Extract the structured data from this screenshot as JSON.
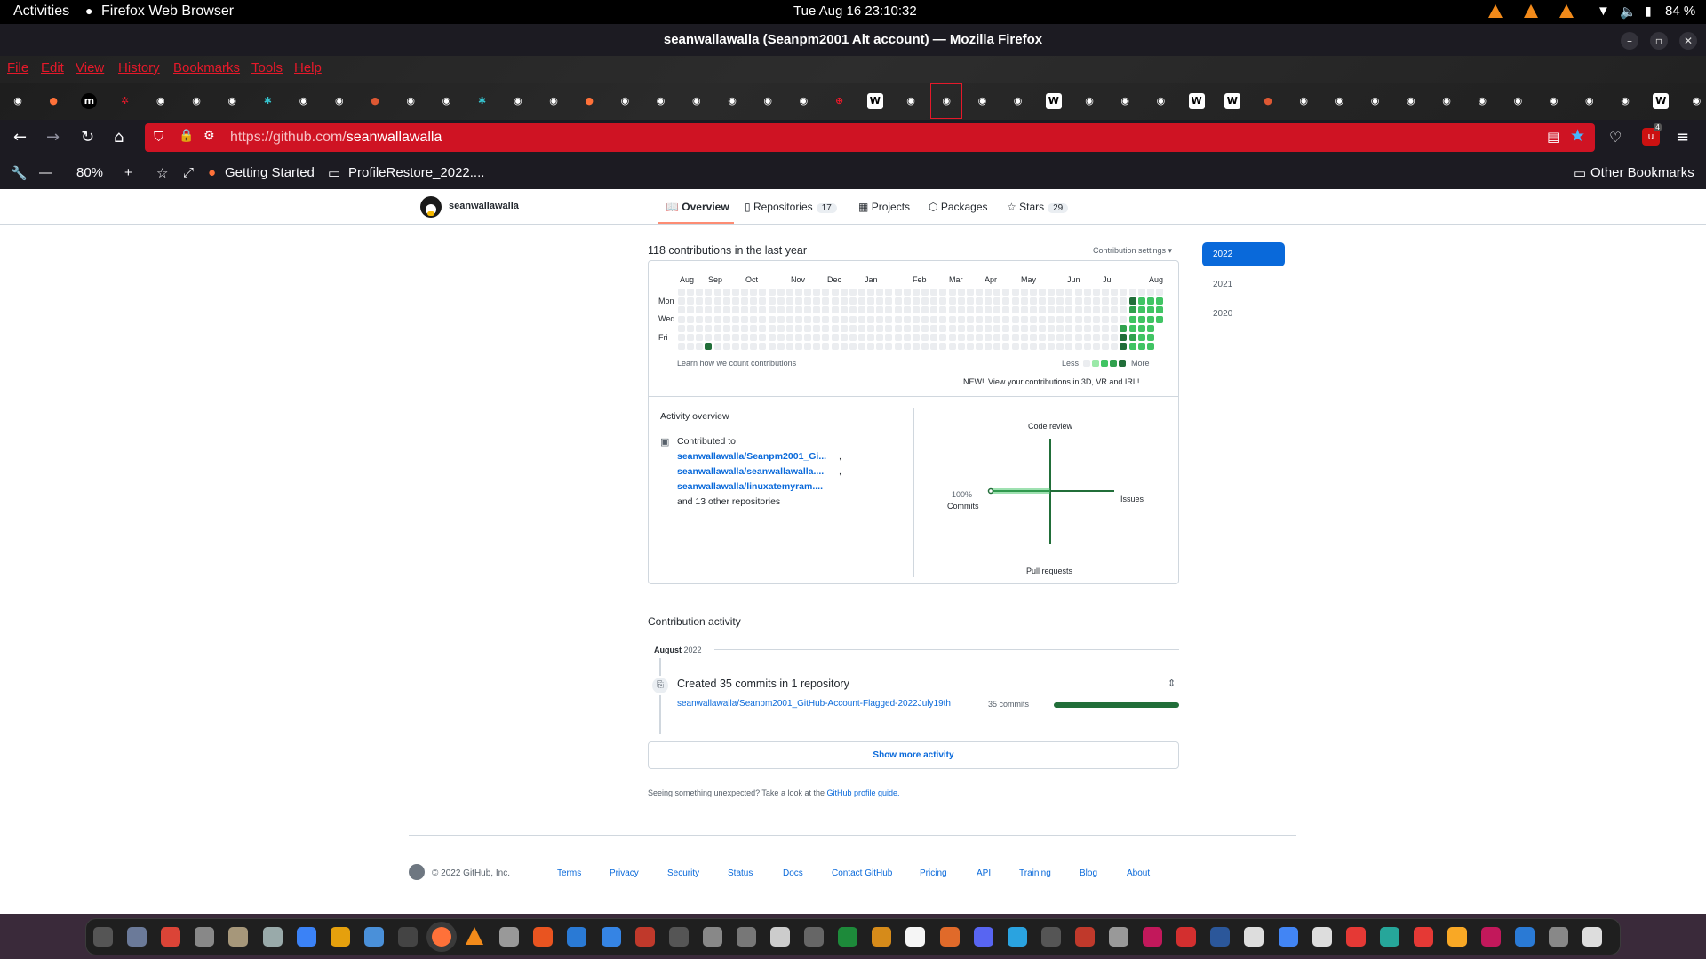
{
  "system": {
    "activities": "Activities",
    "app_name": "Firefox Web Browser",
    "datetime": "Tue Aug 16  23:10:32",
    "battery": "84 %"
  },
  "window": {
    "title": "seanwallawalla (Seanpm2001 Alt account) — Mozilla Firefox"
  },
  "menu": [
    "File",
    "Edit",
    "View",
    "History",
    "Bookmarks",
    "Tools",
    "Help"
  ],
  "tabs": [
    {
      "icon": "github-icon",
      "color": "#ffffff"
    },
    {
      "icon": "firefox-icon",
      "color": "#ff7139"
    },
    {
      "icon": "medium-icon",
      "color": "#ffffff"
    },
    {
      "icon": "settings-icon",
      "color": "#e5192a"
    },
    {
      "icon": "github-icon",
      "color": "#ffffff"
    },
    {
      "icon": "github-icon",
      "color": "#ffffff"
    },
    {
      "icon": "github-icon",
      "color": "#ffffff"
    },
    {
      "icon": "puzzle-icon",
      "color": "#36c5d0"
    },
    {
      "icon": "github-icon",
      "color": "#ffffff"
    },
    {
      "icon": "github-icon",
      "color": "#ffffff"
    },
    {
      "icon": "duckduckgo-icon",
      "color": "#de5833"
    },
    {
      "icon": "github-icon",
      "color": "#ffffff"
    },
    {
      "icon": "github-icon",
      "color": "#ffffff"
    },
    {
      "icon": "puzzle-icon",
      "color": "#36c5d0"
    },
    {
      "icon": "github-icon",
      "color": "#ffffff"
    },
    {
      "icon": "github-icon",
      "color": "#ffffff"
    },
    {
      "icon": "firefox-icon",
      "color": "#ff7139"
    },
    {
      "icon": "github-icon",
      "color": "#ffffff"
    },
    {
      "icon": "github-icon",
      "color": "#ffffff"
    },
    {
      "icon": "github-icon",
      "color": "#ffffff"
    },
    {
      "icon": "github-icon",
      "color": "#ffffff"
    },
    {
      "icon": "github-icon",
      "color": "#ffffff"
    },
    {
      "icon": "github-icon",
      "color": "#ffffff"
    },
    {
      "icon": "globe-icon",
      "color": "#e5192a"
    },
    {
      "icon": "wikipedia-icon",
      "color": "#ffffff"
    },
    {
      "icon": "github-icon",
      "color": "#ffffff"
    },
    {
      "icon": "github-icon",
      "color": "#ffffff",
      "selected": true
    },
    {
      "icon": "github-icon",
      "color": "#ffffff"
    },
    {
      "icon": "github-icon",
      "color": "#ffffff"
    },
    {
      "icon": "wikipedia-icon",
      "color": "#ffffff"
    },
    {
      "icon": "github-icon",
      "color": "#ffffff"
    },
    {
      "icon": "github-icon",
      "color": "#ffffff"
    },
    {
      "icon": "github-icon",
      "color": "#ffffff"
    },
    {
      "icon": "wikipedia-icon",
      "color": "#ffffff"
    },
    {
      "icon": "wikipedia-icon",
      "color": "#ffffff"
    },
    {
      "icon": "duckduckgo-icon",
      "color": "#de5833"
    },
    {
      "icon": "github-icon",
      "color": "#ffffff"
    },
    {
      "icon": "github-icon",
      "color": "#ffffff"
    },
    {
      "icon": "github-icon",
      "color": "#ffffff"
    },
    {
      "icon": "github-icon",
      "color": "#ffffff"
    },
    {
      "icon": "github-icon",
      "color": "#ffffff"
    },
    {
      "icon": "github-icon",
      "color": "#ffffff"
    },
    {
      "icon": "github-icon",
      "color": "#ffffff"
    },
    {
      "icon": "github-icon",
      "color": "#ffffff"
    },
    {
      "icon": "github-icon",
      "color": "#ffffff"
    },
    {
      "icon": "github-icon",
      "color": "#ffffff"
    },
    {
      "icon": "wikipedia-icon",
      "color": "#ffffff"
    },
    {
      "icon": "github-icon",
      "color": "#ffffff"
    }
  ],
  "nav": {
    "url_prefix": "https://github.com/",
    "url_path": "seanwallawalla",
    "notification_count": "4"
  },
  "bookmarks": {
    "zoom": "80%",
    "getting_started": "Getting Started",
    "profile_restore": "ProfileRestore_2022....",
    "other": "Other Bookmarks"
  },
  "profile_nav": {
    "username": "seanwallawalla",
    "tabs": [
      {
        "label": "Overview",
        "icon": "book-icon",
        "selected": true
      },
      {
        "label": "Repositories",
        "icon": "repo-icon",
        "count": "17"
      },
      {
        "label": "Projects",
        "icon": "table-icon"
      },
      {
        "label": "Packages",
        "icon": "package-icon"
      },
      {
        "label": "Stars",
        "icon": "star-icon",
        "count": "29"
      }
    ]
  },
  "contributions": {
    "heading": "118 contributions in the last year",
    "settings": "Contribution settings ▾",
    "months": [
      "Aug",
      "Sep",
      "Oct",
      "Nov",
      "Dec",
      "Jan",
      "Feb",
      "Mar",
      "Apr",
      "May",
      "Jun",
      "Jul",
      "Aug"
    ],
    "days": [
      "Mon",
      "Wed",
      "Fri"
    ],
    "learn": "Learn how we count contributions",
    "less": "Less",
    "more": "More",
    "new_badge": "NEW!",
    "new_link": "View your contributions in 3D, VR and IRL!",
    "colors": [
      "#ebedf0",
      "#9be9a8",
      "#40c463",
      "#30a14e",
      "#216e39"
    ],
    "weeks": 53,
    "active_cells": [
      {
        "week": 3,
        "day": 6,
        "level": 4
      },
      {
        "week": 49,
        "day": 4,
        "level": 3
      },
      {
        "week": 49,
        "day": 5,
        "level": 4
      },
      {
        "week": 49,
        "day": 6,
        "level": 4
      },
      {
        "week": 50,
        "day": 1,
        "level": 4
      },
      {
        "week": 50,
        "day": 2,
        "level": 3
      },
      {
        "week": 50,
        "day": 3,
        "level": 2
      },
      {
        "week": 50,
        "day": 4,
        "level": 2
      },
      {
        "week": 50,
        "day": 5,
        "level": 3
      },
      {
        "week": 50,
        "day": 6,
        "level": 2
      },
      {
        "week": 51,
        "day": 1,
        "level": 2
      },
      {
        "week": 51,
        "day": 2,
        "level": 2
      },
      {
        "week": 51,
        "day": 3,
        "level": 2
      },
      {
        "week": 51,
        "day": 4,
        "level": 2
      },
      {
        "week": 51,
        "day": 5,
        "level": 2
      },
      {
        "week": 51,
        "day": 6,
        "level": 2
      },
      {
        "week": 52,
        "day": 1,
        "level": 2
      },
      {
        "week": 52,
        "day": 2,
        "level": 2
      },
      {
        "week": 52,
        "day": 3,
        "level": 2
      },
      {
        "week": 52,
        "day": 4,
        "level": 2
      },
      {
        "week": 52,
        "day": 5,
        "level": 2
      },
      {
        "week": 52,
        "day": 6,
        "level": 2
      },
      {
        "week": 53,
        "day": 1,
        "level": 2
      },
      {
        "week": 53,
        "day": 2,
        "level": 2
      },
      {
        "week": 53,
        "day": 3,
        "level": 2
      }
    ]
  },
  "years": [
    "2022",
    "2021",
    "2020"
  ],
  "activity_overview": {
    "title": "Activity overview",
    "contributed_to": "Contributed to",
    "repos": [
      "seanwallawalla/Seanpm2001_Gi...",
      "seanwallawalla/seanwallawalla....",
      "seanwallawalla/linuxatemyram...."
    ],
    "others": "and 13 other repositories",
    "axes": {
      "code_review": "Code review",
      "issues": "Issues",
      "pull_requests": "Pull requests",
      "commits_pct": "100%",
      "commits": "Commits"
    },
    "commits_share": 100
  },
  "contribution_activity": {
    "title": "Contribution activity",
    "month": "August",
    "year": "2022",
    "event": "Created 35 commits in 1 repository",
    "repo": "seanwallawalla/Seanpm2001_GitHub-Account-Flagged-2022July19th",
    "repo_commits": "35 commits",
    "bar_fraction": 1.0,
    "show_more": "Show more activity",
    "unexpected": "Seeing something unexpected? Take a look at the",
    "guide": "GitHub profile guide."
  },
  "footer": {
    "copyright": "© 2022 GitHub, Inc.",
    "links": [
      "Terms",
      "Privacy",
      "Security",
      "Status",
      "Docs",
      "Contact GitHub",
      "Pricing",
      "API",
      "Training",
      "Blog",
      "About"
    ]
  },
  "dock": [
    {
      "icon": "terminal-icon",
      "color": "#555"
    },
    {
      "icon": "files-icon",
      "color": "#6b7a99"
    },
    {
      "icon": "chrome-icon",
      "color": "#db4437"
    },
    {
      "icon": "text-editor-icon",
      "color": "#888"
    },
    {
      "icon": "archive-icon",
      "color": "#a6977a"
    },
    {
      "icon": "screenshot-icon",
      "color": "#9aa"
    },
    {
      "icon": "docs-icon",
      "color": "#3b82f6"
    },
    {
      "icon": "office-icon",
      "color": "#e5a00d"
    },
    {
      "icon": "notes-icon",
      "color": "#4a90d9"
    },
    {
      "icon": "console-icon",
      "color": "#444"
    },
    {
      "icon": "firefox-icon",
      "color": "#ff7139"
    },
    {
      "icon": "vlc-icon",
      "color": "#f28a1a"
    },
    {
      "icon": "disk-icon",
      "color": "#999"
    },
    {
      "icon": "ubuntu-software-icon",
      "color": "#e95420"
    },
    {
      "icon": "writer-icon",
      "color": "#2a7ad5"
    },
    {
      "icon": "help-icon",
      "color": "#3584e4"
    },
    {
      "icon": "monitor-icon",
      "color": "#c0392b"
    },
    {
      "icon": "obs-icon",
      "color": "#555"
    },
    {
      "icon": "bug-icon",
      "color": "#888"
    },
    {
      "icon": "inkscape-icon",
      "color": "#777"
    },
    {
      "icon": "cube-icon",
      "color": "#ccc"
    },
    {
      "icon": "camera-icon",
      "color": "#666"
    },
    {
      "icon": "calc-icon",
      "color": "#1d8a3a"
    },
    {
      "icon": "impress-icon",
      "color": "#d68b1a"
    },
    {
      "icon": "draw-icon",
      "color": "#f5f5f5"
    },
    {
      "icon": "calendar-icon",
      "color": "#e06a2a"
    },
    {
      "icon": "discord-icon",
      "color": "#5865f2"
    },
    {
      "icon": "telegram-icon",
      "color": "#2aa3e0"
    },
    {
      "icon": "steam-icon",
      "color": "#555"
    },
    {
      "icon": "pdf-icon",
      "color": "#c0392b"
    },
    {
      "icon": "percent-icon",
      "color": "#999"
    },
    {
      "icon": "tv-icon",
      "color": "#c2185b"
    },
    {
      "icon": "game-icon",
      "color": "#d32f2f"
    },
    {
      "icon": "word-icon",
      "color": "#2b579a"
    },
    {
      "icon": "github-desktop-icon",
      "color": "#ddd"
    },
    {
      "icon": "translate-icon",
      "color": "#4285f4"
    },
    {
      "icon": "clock-icon",
      "color": "#ddd"
    },
    {
      "icon": "heart-icon",
      "color": "#e53935"
    },
    {
      "icon": "map-icon",
      "color": "#26a69a"
    },
    {
      "icon": "mario-icon",
      "color": "#e53935"
    },
    {
      "icon": "wallet-icon",
      "color": "#f9a825"
    },
    {
      "icon": "tool-icon",
      "color": "#c2185b"
    },
    {
      "icon": "vscode-icon",
      "color": "#2a7ad5"
    },
    {
      "icon": "trash-icon",
      "color": "#888"
    },
    {
      "icon": "apps-grid-icon",
      "color": "#ddd"
    }
  ]
}
